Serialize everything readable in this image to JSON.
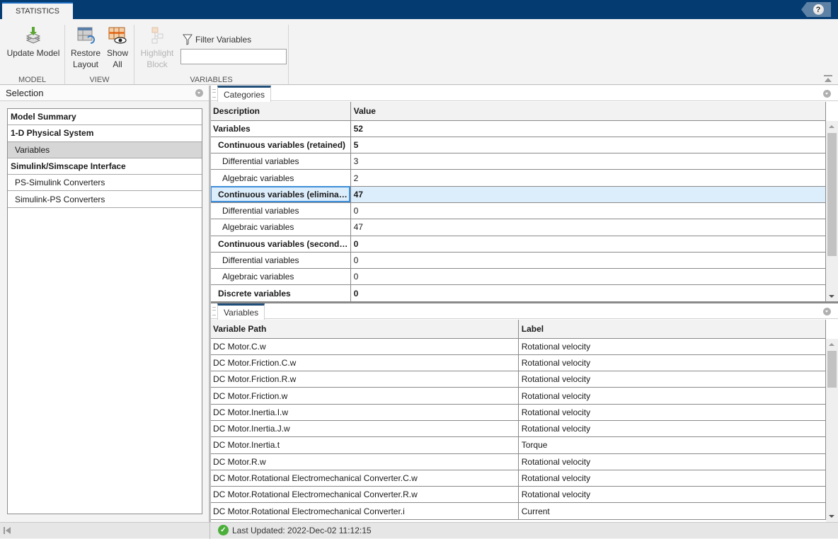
{
  "toolstrip": {
    "tab_label": "STATISTICS",
    "help_label": "?"
  },
  "ribbon": {
    "groups": {
      "model": {
        "label": "MODEL",
        "update_model": "Update Model"
      },
      "view": {
        "label": "VIEW",
        "restore_layout_1": "Restore",
        "restore_layout_2": "Layout",
        "show_all_1": "Show",
        "show_all_2": "All"
      },
      "variables": {
        "label": "VARIABLES",
        "highlight_1": "Highlight",
        "highlight_2": "Block",
        "filter_label": "Filter Variables",
        "filter_value": "",
        "filter_placeholder": ""
      }
    }
  },
  "selection": {
    "title": "Selection",
    "items": [
      {
        "label": "Model Summary",
        "style": "bold"
      },
      {
        "label": "1-D Physical System",
        "style": "bold"
      },
      {
        "label": "Variables",
        "style": "sub",
        "selected": true
      },
      {
        "label": "Simulink/Simscape Interface",
        "style": "bold"
      },
      {
        "label": "PS-Simulink Converters",
        "style": "sub"
      },
      {
        "label": "Simulink-PS Converters",
        "style": "sub"
      }
    ]
  },
  "categories": {
    "tab_label": "Categories",
    "columns": [
      "Description",
      "Value"
    ],
    "rows": [
      {
        "description": "Variables",
        "value": "52",
        "level": 0,
        "bold": true
      },
      {
        "description": "Continuous variables (retained)",
        "value": "5",
        "level": 1,
        "bold": true
      },
      {
        "description": "Differential variables",
        "value": "3",
        "level": 2,
        "bold": false
      },
      {
        "description": "Algebraic variables",
        "value": "2",
        "level": 2,
        "bold": false
      },
      {
        "description": "Continuous variables (elimina…",
        "value": "47",
        "level": 1,
        "bold": true,
        "selected": true
      },
      {
        "description": "Differential variables",
        "value": "0",
        "level": 2,
        "bold": false
      },
      {
        "description": "Algebraic variables",
        "value": "47",
        "level": 2,
        "bold": false
      },
      {
        "description": "Continuous variables (second…",
        "value": "0",
        "level": 1,
        "bold": true
      },
      {
        "description": "Differential variables",
        "value": "0",
        "level": 2,
        "bold": false
      },
      {
        "description": "Algebraic variables",
        "value": "0",
        "level": 2,
        "bold": false
      },
      {
        "description": "Discrete variables",
        "value": "0",
        "level": 1,
        "bold": true
      }
    ]
  },
  "variables": {
    "tab_label": "Variables",
    "columns": [
      "Variable Path",
      "Label"
    ],
    "rows": [
      {
        "path": "DC Motor.C.w",
        "label": "Rotational velocity"
      },
      {
        "path": "DC Motor.Friction.C.w",
        "label": "Rotational velocity"
      },
      {
        "path": "DC Motor.Friction.R.w",
        "label": "Rotational velocity"
      },
      {
        "path": "DC Motor.Friction.w",
        "label": "Rotational velocity"
      },
      {
        "path": "DC Motor.Inertia.I.w",
        "label": "Rotational velocity"
      },
      {
        "path": "DC Motor.Inertia.J.w",
        "label": "Rotational velocity"
      },
      {
        "path": "DC Motor.Inertia.t",
        "label": "Torque"
      },
      {
        "path": "DC Motor.R.w",
        "label": "Rotational velocity"
      },
      {
        "path": "DC Motor.Rotational Electromechanical Converter.C.w",
        "label": "Rotational velocity"
      },
      {
        "path": "DC Motor.Rotational Electromechanical Converter.R.w",
        "label": "Rotational velocity"
      },
      {
        "path": "DC Motor.Rotational Electromechanical Converter.i",
        "label": "Current"
      }
    ]
  },
  "status": {
    "text": "Last Updated: 2022-Dec-02 11:12:15",
    "icon": "check-circle-icon"
  }
}
